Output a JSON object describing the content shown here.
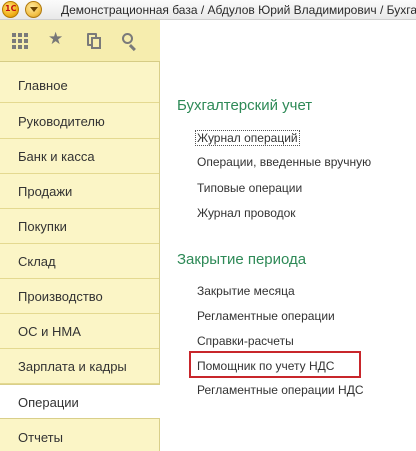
{
  "window": {
    "title": "Демонстрационная база / Абдулов Юрий Владимирович / Бухгалтерия",
    "logo_text": "1С"
  },
  "toolbar": {
    "icons": [
      "apps-grid-icon",
      "star-icon",
      "history-icon",
      "search-icon"
    ]
  },
  "sections": [
    {
      "label": "Главное"
    },
    {
      "label": "Руководителю"
    },
    {
      "label": "Банк и касса"
    },
    {
      "label": "Продажи"
    },
    {
      "label": "Покупки"
    },
    {
      "label": "Склад"
    },
    {
      "label": "Производство"
    },
    {
      "label": "ОС и НМА"
    },
    {
      "label": "Зарплата и кадры"
    },
    {
      "label": "Операции"
    },
    {
      "label": "Отчеты"
    }
  ],
  "active_section": "Операции",
  "groups": [
    {
      "title": "Бухгалтерский учет",
      "commands": [
        {
          "label": "Журнал операций"
        },
        {
          "label": "Операции, введенные вручную"
        },
        {
          "label": "Типовые операции"
        },
        {
          "label": "Журнал проводок"
        }
      ]
    },
    {
      "title": "Закрытие периода",
      "commands": [
        {
          "label": "Закрытие месяца"
        },
        {
          "label": "Регламентные операции"
        },
        {
          "label": "Справки-расчеты"
        },
        {
          "label": "Помощник по учету НДС"
        },
        {
          "label": "Регламентные операции НДС"
        }
      ]
    }
  ],
  "colors": {
    "sections_background": "#fbf5c6",
    "group_title": "#2e8a57",
    "highlight_frame": "#c8262b"
  }
}
